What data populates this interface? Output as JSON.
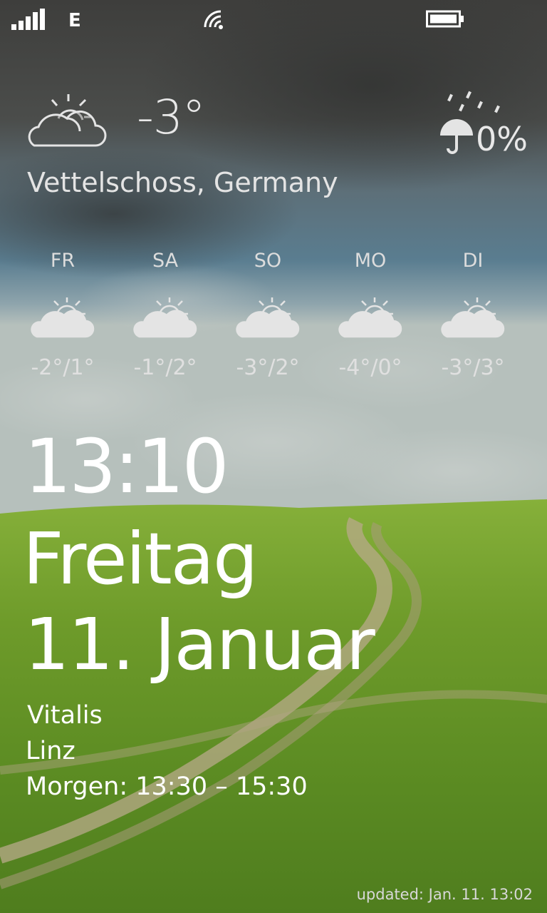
{
  "status_bar": {
    "signal_icon": "signal-bars-icon",
    "network_type": "E",
    "wifi_icon": "wifi-icon",
    "battery_icon": "battery-full-icon"
  },
  "weather": {
    "current_icon": "partly-cloudy-icon",
    "temperature": "-3°",
    "precip_icon": "umbrella-rain-icon",
    "precipitation": "0%",
    "location": "Vettelschoss, Germany",
    "forecast": [
      {
        "day": "FR",
        "icon": "partly-cloudy-icon",
        "range": "-2°/1°"
      },
      {
        "day": "SA",
        "icon": "partly-cloudy-icon",
        "range": "-1°/2°"
      },
      {
        "day": "SO",
        "icon": "partly-cloudy-icon",
        "range": "-3°/2°"
      },
      {
        "day": "MO",
        "icon": "partly-cloudy-icon",
        "range": "-4°/0°"
      },
      {
        "day": "DI",
        "icon": "partly-cloudy-icon",
        "range": "-3°/3°"
      }
    ]
  },
  "lockscreen": {
    "time": "13:10",
    "weekday": "Freitag",
    "date": "11. Januar"
  },
  "event": {
    "title": "Vitalis",
    "location": "Linz",
    "when": "Morgen: 13:30 – 15:30"
  },
  "footer": {
    "updated": "updated: Jan. 11. 13:02"
  },
  "colors": {
    "sky_top": "#4a4a48",
    "sky_mid": "#5f7a86",
    "grass": "#6f9a2e",
    "path": "#b8a98a",
    "text": "#ffffff"
  }
}
